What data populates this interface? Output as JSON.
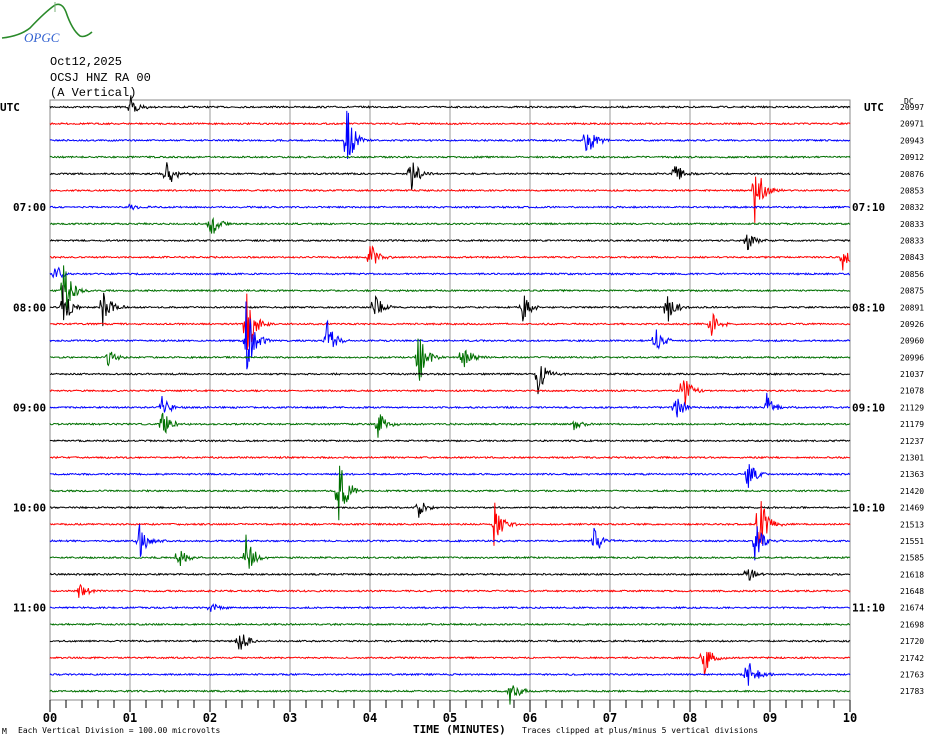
{
  "logo_text": "OPGC",
  "header": {
    "date": "Oct12,2025",
    "station": "OCSJ HNZ RA 00",
    "component": "(A Vertical)"
  },
  "chart_data": {
    "type": "line",
    "title": "OCSJ HNZ RA 00 (A Vertical) Oct12,2025",
    "xlabel": "TIME (MINUTES)",
    "xlim": [
      0,
      10
    ],
    "x_ticks": [
      "00",
      "01",
      "02",
      "03",
      "04",
      "05",
      "06",
      "07",
      "08",
      "09",
      "10"
    ],
    "left_axis_label": "UTC",
    "right_axis_label": "UTC",
    "dc_label": "DC",
    "left_time_labels": [
      {
        "row": 6,
        "text": "07:00"
      },
      {
        "row": 12,
        "text": "08:00"
      },
      {
        "row": 18,
        "text": "09:00"
      },
      {
        "row": 24,
        "text": "10:00"
      },
      {
        "row": 30,
        "text": "11:00"
      }
    ],
    "right_time_labels": [
      {
        "row": 6,
        "text": "07:10"
      },
      {
        "row": 12,
        "text": "08:10"
      },
      {
        "row": 18,
        "text": "09:10"
      },
      {
        "row": 24,
        "text": "10:10"
      },
      {
        "row": 30,
        "text": "11:10"
      }
    ],
    "trace_colors": [
      "#000000",
      "#ff0000",
      "#0000ff",
      "#007000"
    ],
    "dc_offsets": [
      "20997",
      "20971",
      "20943",
      "20912",
      "20876",
      "20853",
      "20832",
      "20833",
      "20833",
      "20843",
      "20856",
      "20875",
      "20891",
      "20926",
      "20960",
      "20996",
      "21037",
      "21078",
      "21129",
      "21179",
      "21237",
      "21301",
      "21363",
      "21420",
      "21469",
      "21513",
      "21551",
      "21585",
      "21618",
      "21648",
      "21674",
      "21698",
      "21720",
      "21742",
      "21763",
      "21783"
    ],
    "events": [
      {
        "row": 0,
        "minute": 1.0,
        "amp": 1.5
      },
      {
        "row": 2,
        "minute": 3.7,
        "amp": 5
      },
      {
        "row": 2,
        "minute": 6.7,
        "amp": 3
      },
      {
        "row": 4,
        "minute": 1.45,
        "amp": 2.5
      },
      {
        "row": 4,
        "minute": 4.5,
        "amp": 2.5
      },
      {
        "row": 4,
        "minute": 7.8,
        "amp": 2
      },
      {
        "row": 5,
        "minute": 8.8,
        "amp": 5
      },
      {
        "row": 6,
        "minute": 1.0,
        "amp": 0.8
      },
      {
        "row": 7,
        "minute": 2.0,
        "amp": 2
      },
      {
        "row": 8,
        "minute": 8.7,
        "amp": 1.5
      },
      {
        "row": 9,
        "minute": 4.0,
        "amp": 2
      },
      {
        "row": 9,
        "minute": 9.9,
        "amp": 2
      },
      {
        "row": 10,
        "minute": 0.05,
        "amp": 1.5
      },
      {
        "row": 11,
        "minute": 0.15,
        "amp": 5
      },
      {
        "row": 12,
        "minute": 0.15,
        "amp": 3
      },
      {
        "row": 12,
        "minute": 0.65,
        "amp": 3
      },
      {
        "row": 12,
        "minute": 4.05,
        "amp": 2
      },
      {
        "row": 12,
        "minute": 5.9,
        "amp": 2
      },
      {
        "row": 12,
        "minute": 7.7,
        "amp": 2.5
      },
      {
        "row": 13,
        "minute": 2.45,
        "amp": 5
      },
      {
        "row": 13,
        "minute": 8.25,
        "amp": 2
      },
      {
        "row": 14,
        "minute": 2.45,
        "amp": 5
      },
      {
        "row": 14,
        "minute": 3.45,
        "amp": 3
      },
      {
        "row": 14,
        "minute": 7.55,
        "amp": 2
      },
      {
        "row": 15,
        "minute": 0.7,
        "amp": 1.5
      },
      {
        "row": 15,
        "minute": 4.6,
        "amp": 4
      },
      {
        "row": 15,
        "minute": 5.15,
        "amp": 2
      },
      {
        "row": 16,
        "minute": 6.1,
        "amp": 3
      },
      {
        "row": 17,
        "minute": 7.9,
        "amp": 3
      },
      {
        "row": 18,
        "minute": 1.4,
        "amp": 1.5
      },
      {
        "row": 18,
        "minute": 7.8,
        "amp": 3
      },
      {
        "row": 18,
        "minute": 8.95,
        "amp": 2
      },
      {
        "row": 19,
        "minute": 1.4,
        "amp": 2
      },
      {
        "row": 19,
        "minute": 4.1,
        "amp": 2
      },
      {
        "row": 19,
        "minute": 6.55,
        "amp": 1
      },
      {
        "row": 22,
        "minute": 8.7,
        "amp": 3
      },
      {
        "row": 23,
        "minute": 3.6,
        "amp": 5
      },
      {
        "row": 24,
        "minute": 4.6,
        "amp": 1.5
      },
      {
        "row": 25,
        "minute": 5.55,
        "amp": 3
      },
      {
        "row": 25,
        "minute": 8.85,
        "amp": 5
      },
      {
        "row": 26,
        "minute": 1.1,
        "amp": 3
      },
      {
        "row": 26,
        "minute": 6.8,
        "amp": 2
      },
      {
        "row": 26,
        "minute": 8.8,
        "amp": 3
      },
      {
        "row": 27,
        "minute": 1.6,
        "amp": 1.5
      },
      {
        "row": 27,
        "minute": 2.45,
        "amp": 3
      },
      {
        "row": 28,
        "minute": 8.7,
        "amp": 1.5
      },
      {
        "row": 29,
        "minute": 0.35,
        "amp": 1.5
      },
      {
        "row": 30,
        "minute": 2.0,
        "amp": 0.8
      },
      {
        "row": 32,
        "minute": 2.35,
        "amp": 2
      },
      {
        "row": 33,
        "minute": 8.15,
        "amp": 3
      },
      {
        "row": 34,
        "minute": 8.7,
        "amp": 3
      },
      {
        "row": 35,
        "minute": 5.75,
        "amp": 2
      }
    ],
    "vertical_division_microvolts": 100.0
  },
  "footer": {
    "corner": "M",
    "division_note": "Each Vertical Division =  100.00 microvolts",
    "clip_note": "Traces clipped at plus/minus 5 vertical divisions"
  }
}
